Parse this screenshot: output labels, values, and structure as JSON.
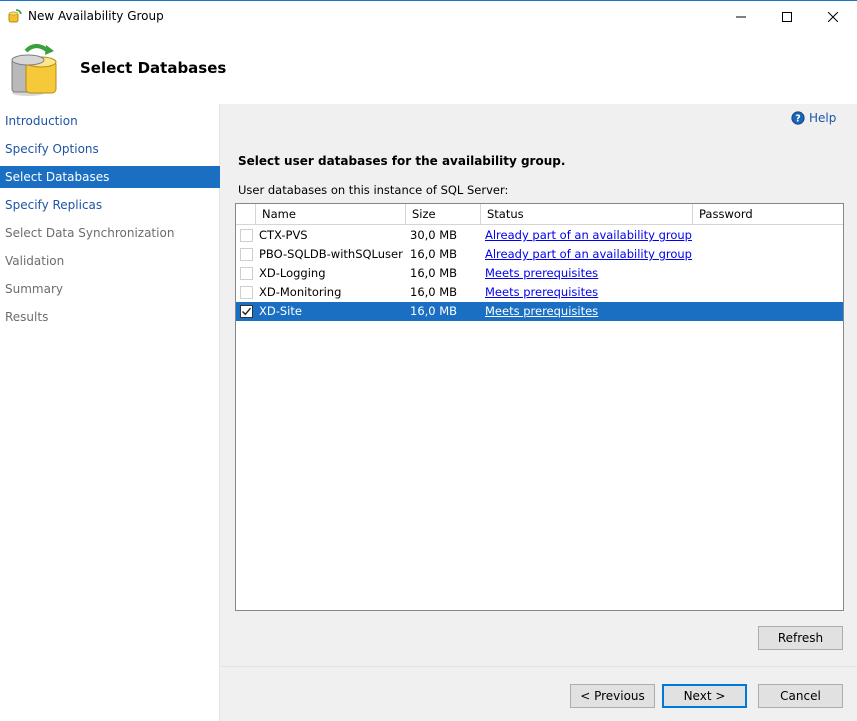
{
  "window": {
    "title": "New Availability Group"
  },
  "header": {
    "title": "Select Databases"
  },
  "nav": {
    "items": [
      {
        "label": "Introduction",
        "state": "link"
      },
      {
        "label": "Specify Options",
        "state": "link"
      },
      {
        "label": "Select Databases",
        "state": "active"
      },
      {
        "label": "Specify Replicas",
        "state": "link"
      },
      {
        "label": "Select Data Synchronization",
        "state": "disabled"
      },
      {
        "label": "Validation",
        "state": "disabled"
      },
      {
        "label": "Summary",
        "state": "disabled"
      },
      {
        "label": "Results",
        "state": "disabled"
      }
    ]
  },
  "main": {
    "help_label": "Help",
    "instruction": "Select user databases for the availability group.",
    "grid_label": "User databases on this instance of SQL Server:",
    "columns": [
      "Name",
      "Size",
      "Status",
      "Password"
    ],
    "rows": [
      {
        "name": "CTX-PVS",
        "size": "30,0 MB",
        "status": "Already part of an availability group",
        "checked": false
      },
      {
        "name": "PBO-SQLDB-withSQLuser",
        "size": "16,0 MB",
        "status": "Already part of an availability group",
        "checked": false
      },
      {
        "name": "XD-Logging",
        "size": "16,0 MB",
        "status": "Meets prerequisites",
        "checked": false
      },
      {
        "name": "XD-Monitoring",
        "size": "16,0 MB",
        "status": "Meets prerequisites",
        "checked": false
      },
      {
        "name": "XD-Site",
        "size": "16,0 MB",
        "status": "Meets prerequisites",
        "checked": true
      }
    ],
    "refresh_label": "Refresh"
  },
  "footer": {
    "previous_label": "< Previous",
    "next_label": "Next >",
    "cancel_label": "Cancel"
  },
  "colors": {
    "accent": "#1b6fc2",
    "link": "#1d54a6"
  }
}
